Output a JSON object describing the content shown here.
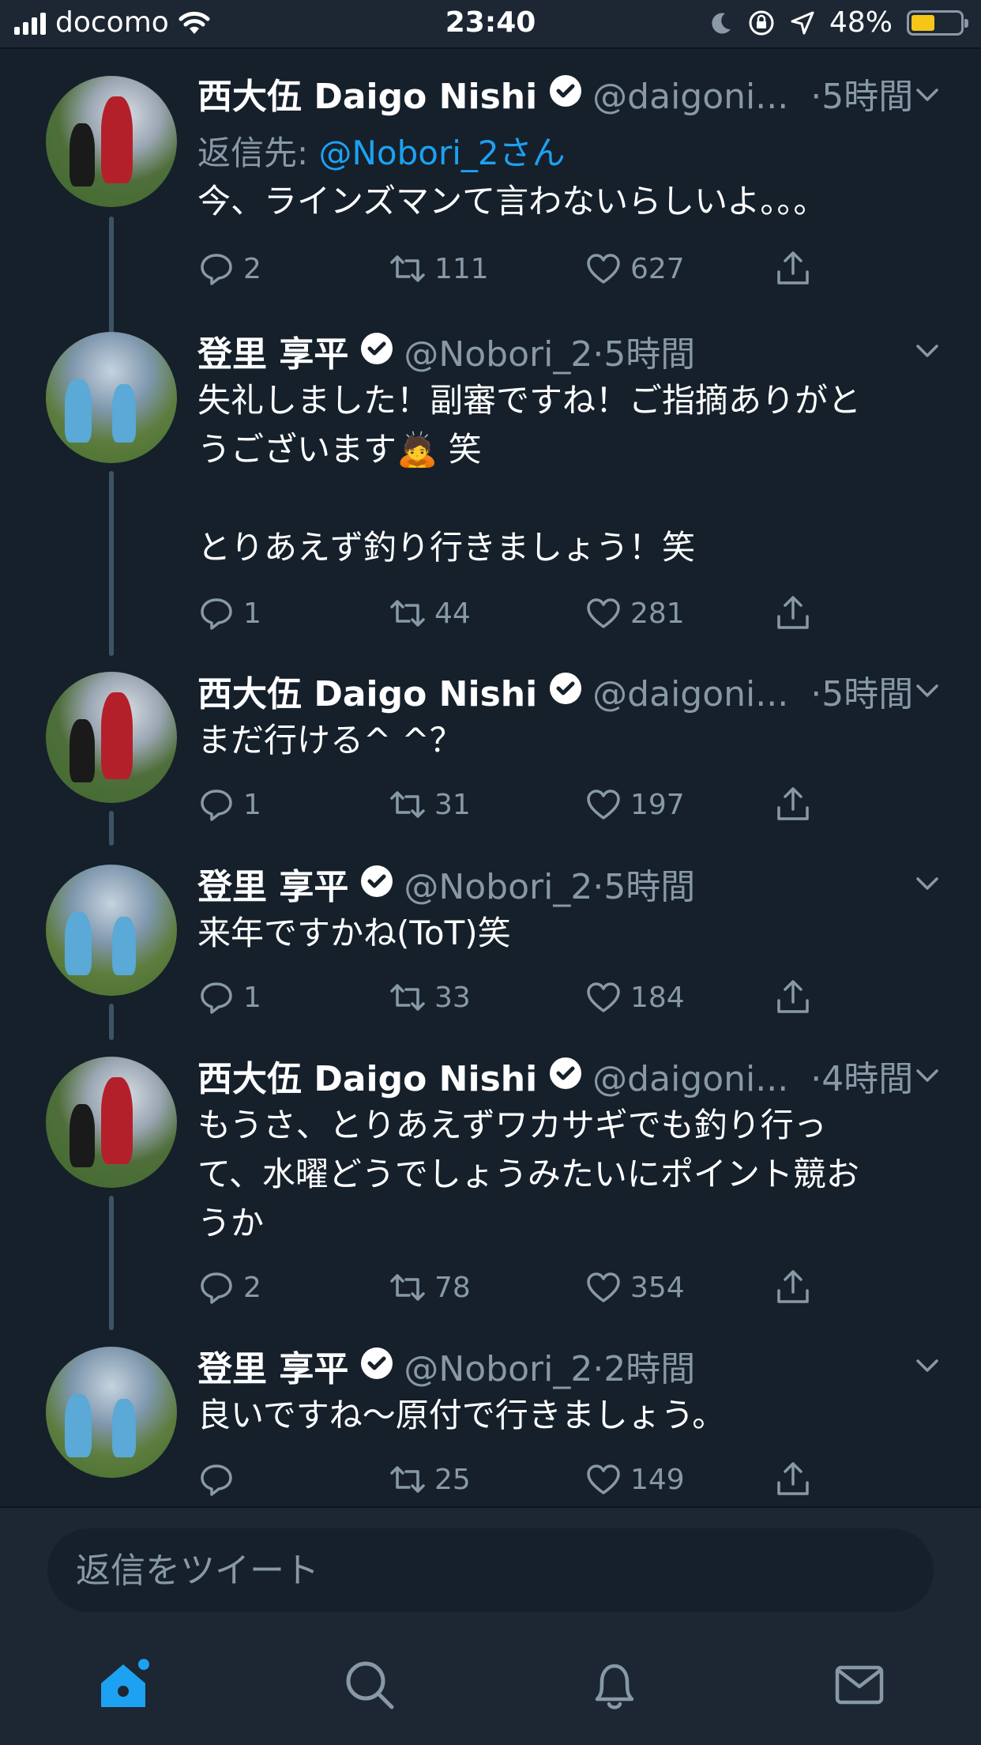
{
  "status_bar": {
    "carrier": "docomo",
    "time": "23:40",
    "battery_percent": "48%",
    "battery_level": 0.48,
    "icons": [
      "signal-icon",
      "wifi-icon",
      "moon-icon",
      "rotation-lock-icon",
      "location-icon",
      "battery-icon"
    ]
  },
  "colors": {
    "background": "#15202b",
    "bar": "#1c2733",
    "accent": "#1da1f2",
    "secondary_text": "#8899a6"
  },
  "tweets": [
    {
      "name": "西大伍 Daigo Nishi",
      "handle": "@daigoni...",
      "time": "·5時間",
      "reply_prefix": "返信先: ",
      "reply_to": "@Nobori_2さん",
      "text": "今、ラインズマンて言わないらしいよ。。。",
      "replies": "2",
      "retweets": "111",
      "likes": "627"
    },
    {
      "name": "登里 享平",
      "handle": "@Nobori_2",
      "time": "·5時間",
      "text": "失礼しました！副審ですね！ご指摘ありがと\nうございます🙇 笑\n\nとりあえず釣り行きましょう！笑",
      "replies": "1",
      "retweets": "44",
      "likes": "281"
    },
    {
      "name": "西大伍 Daigo Nishi",
      "handle": "@daigoni...",
      "time": "·5時間",
      "text": "まだ行ける^ ^？",
      "replies": "1",
      "retweets": "31",
      "likes": "197"
    },
    {
      "name": "登里 享平",
      "handle": "@Nobori_2",
      "time": "·5時間",
      "text": "来年ですかね(ToT)笑",
      "replies": "1",
      "retweets": "33",
      "likes": "184"
    },
    {
      "name": "西大伍 Daigo Nishi",
      "handle": "@daigoni...",
      "time": "·4時間",
      "text": "もうさ、とりあえずワカサギでも釣り行っ\nて、水曜どうでしょうみたいにポイント競お\nうか",
      "replies": "2",
      "retweets": "78",
      "likes": "354"
    },
    {
      "name": "登里 享平",
      "handle": "@Nobori_2",
      "time": "·2時間",
      "text": "良いですね〜原付で行きましょう。",
      "replies": "",
      "retweets": "25",
      "likes": "149"
    }
  ],
  "reply_bar": {
    "placeholder": "返信をツイート"
  },
  "tab_bar": {
    "items": [
      "home-icon",
      "search-icon",
      "notifications-icon",
      "messages-icon"
    ],
    "active": "home-icon"
  }
}
